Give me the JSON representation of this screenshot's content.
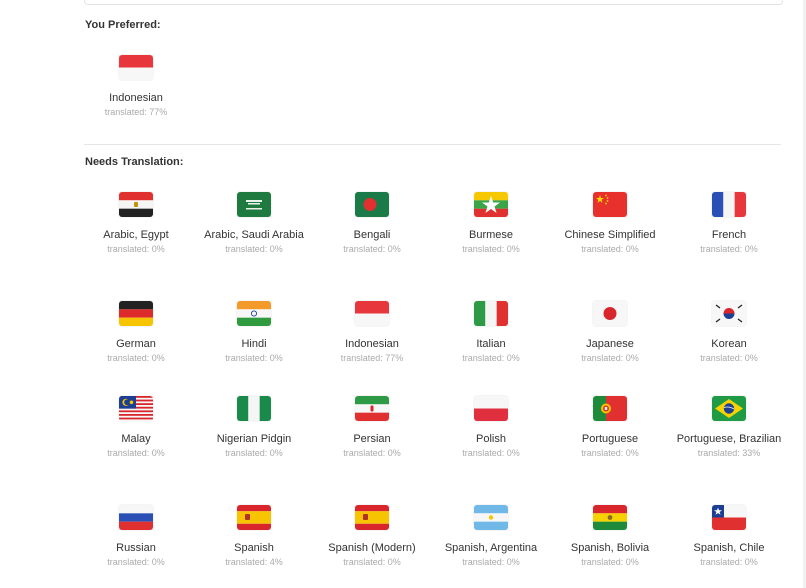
{
  "preferred": {
    "heading": "You Preferred:",
    "items": [
      {
        "name": "Indonesian",
        "status": "translated: 77%",
        "flag": "indonesia-flag"
      }
    ]
  },
  "needs": {
    "heading": "Needs Translation:",
    "items": [
      {
        "name": "Arabic, Egypt",
        "status": "translated: 0%",
        "flag": "egypt-flag"
      },
      {
        "name": "Arabic, Saudi Arabia",
        "status": "translated: 0%",
        "flag": "saudi-arabia-flag"
      },
      {
        "name": "Bengali",
        "status": "translated: 0%",
        "flag": "bangladesh-flag"
      },
      {
        "name": "Burmese",
        "status": "translated: 0%",
        "flag": "myanmar-flag"
      },
      {
        "name": "Chinese Simplified",
        "status": "translated: 0%",
        "flag": "china-flag"
      },
      {
        "name": "French",
        "status": "translated: 0%",
        "flag": "france-flag"
      },
      {
        "name": "German",
        "status": "translated: 0%",
        "flag": "germany-flag"
      },
      {
        "name": "Hindi",
        "status": "translated: 0%",
        "flag": "india-flag"
      },
      {
        "name": "Indonesian",
        "status": "translated: 77%",
        "flag": "indonesia-flag"
      },
      {
        "name": "Italian",
        "status": "translated: 0%",
        "flag": "italy-flag"
      },
      {
        "name": "Japanese",
        "status": "translated: 0%",
        "flag": "japan-flag"
      },
      {
        "name": "Korean",
        "status": "translated: 0%",
        "flag": "south-korea-flag"
      },
      {
        "name": "Malay",
        "status": "translated: 0%",
        "flag": "malaysia-flag"
      },
      {
        "name": "Nigerian Pidgin",
        "status": "translated: 0%",
        "flag": "nigeria-flag"
      },
      {
        "name": "Persian",
        "status": "translated: 0%",
        "flag": "iran-flag"
      },
      {
        "name": "Polish",
        "status": "translated: 0%",
        "flag": "poland-flag"
      },
      {
        "name": "Portuguese",
        "status": "translated: 0%",
        "flag": "portugal-flag"
      },
      {
        "name": "Portuguese, Brazilian",
        "status": "translated: 33%",
        "flag": "brazil-flag"
      },
      {
        "name": "Russian",
        "status": "translated: 0%",
        "flag": "russia-flag"
      },
      {
        "name": "Spanish",
        "status": "translated: 4%",
        "flag": "spain-flag"
      },
      {
        "name": "Spanish (Modern)",
        "status": "translated: 0%",
        "flag": "spain-flag"
      },
      {
        "name": "Spanish, Argentina",
        "status": "translated: 0%",
        "flag": "argentina-flag"
      },
      {
        "name": "Spanish, Bolivia",
        "status": "translated: 0%",
        "flag": "bolivia-flag"
      },
      {
        "name": "Spanish, Chile",
        "status": "translated: 0%",
        "flag": "chile-flag"
      }
    ]
  }
}
